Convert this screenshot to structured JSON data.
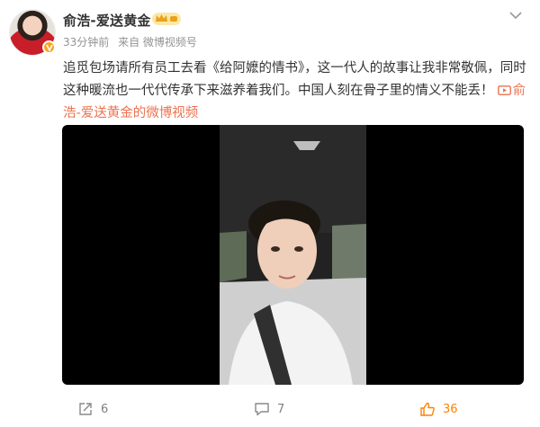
{
  "author": {
    "name": "俞浩-爱送黄金",
    "badge_color": "#f5a623"
  },
  "meta": {
    "time": "33分钟前",
    "source": "来自 微博视频号"
  },
  "post": {
    "text": "追觅包场请所有员工去看《给阿嬷的情书》，这一代人的故事让我非常敬佩，同时这种暖流也一代代传承下来滋养着我们。中国人刻在骨子里的情义不能丢！",
    "link_label": "俞浩-爱送黄金的微博视频",
    "link_color": "#eb7350"
  },
  "actions": {
    "repost_count": "6",
    "comment_count": "7",
    "like_count": "36",
    "like_color": "#ff8200"
  },
  "icons": {
    "more": "chevron-down-icon",
    "repost": "share-icon",
    "comment": "comment-icon",
    "like": "thumb-up-icon",
    "video": "video-icon",
    "verified": "verified-badge-icon",
    "member": "crown-icon"
  }
}
